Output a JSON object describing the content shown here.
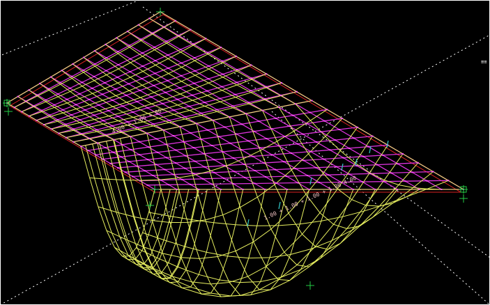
{
  "viewport": {
    "background": "#000000",
    "frame_color": "#ffffff"
  },
  "colors": {
    "undeformed_mesh": "#dd33dd",
    "deformed_mesh": "#e8f060",
    "slab_outline": "#dd2222",
    "grid_axis": "#ffffff",
    "support": "#22cc44",
    "load_arrow": "#33cccc",
    "node": "#ff55ff",
    "dimension": "#f0c0c0"
  },
  "annotations": {
    "dimension_text_upper": "4.00 + 1.00 + 00+",
    "dimension_text_lower": "1.00 + 1.00 + 1.00 + 1.00 4.00",
    "corner_mark": "≡≡"
  },
  "mesh": {
    "rows": 14,
    "cols": 20,
    "deflection_center": 0.78,
    "deflection_depth": 1.0
  }
}
